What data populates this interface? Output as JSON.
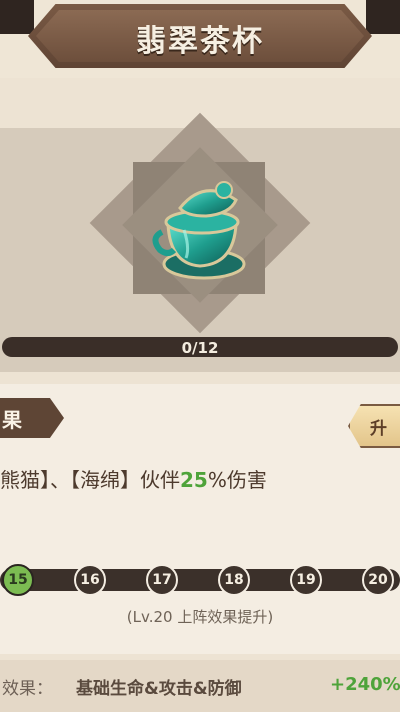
{
  "header": {
    "title": "翡翠茶杯"
  },
  "item": {
    "icon": "jade-teacup-icon"
  },
  "progress": {
    "text": "0/12",
    "fraction": 0
  },
  "effect": {
    "tab_label": "果",
    "upgrade_label": "升",
    "description_prefix": "熊猫】、【海绵】伙伴",
    "description_value": "25",
    "description_suffix": "%伤害"
  },
  "levels": {
    "nodes": [
      "15",
      "16",
      "17",
      "18",
      "19",
      "20"
    ],
    "active": "15",
    "note": "(Lv.20 上阵效果提升)"
  },
  "bottom": {
    "label": "效果：",
    "stat": "基础生命&攻击&防御",
    "bonus": "+240%"
  },
  "colors": {
    "accent_green": "#4ea33a",
    "brown": "#5e4535"
  }
}
